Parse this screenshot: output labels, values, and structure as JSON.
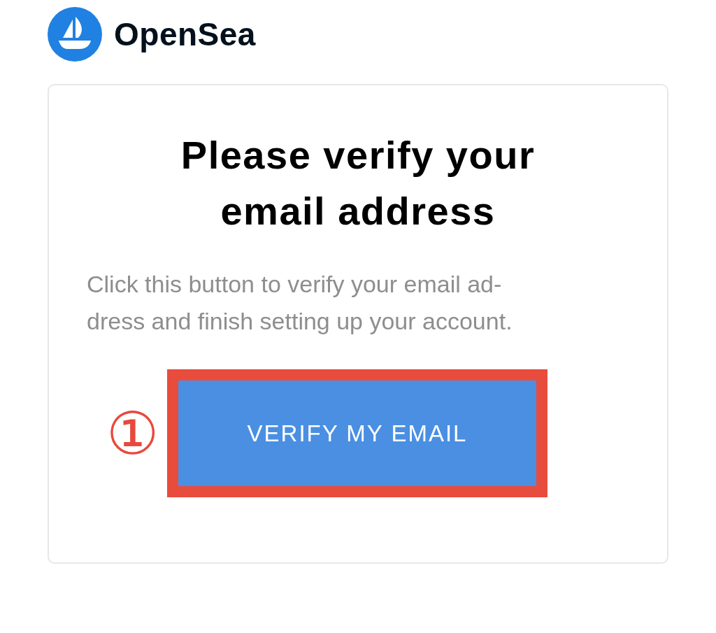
{
  "brand": {
    "name": "OpenSea"
  },
  "card": {
    "heading_lines": [
      "Please verify your",
      "email address"
    ],
    "body_lines": [
      "Click this button to verify your email ad-",
      "dress and finish setting up your account."
    ],
    "button": {
      "label": "VERIFY MY EMAIL",
      "highlighted": true
    },
    "annotation": {
      "marker": "①"
    }
  }
}
